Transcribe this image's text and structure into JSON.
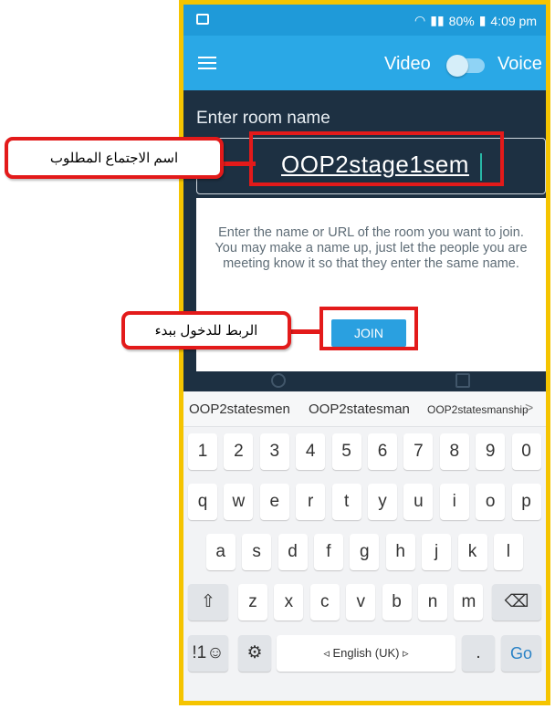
{
  "status_bar": {
    "time": "4:09 pm",
    "battery": "80%"
  },
  "app_bar": {
    "video_label": "Video",
    "voice_label": "Voice"
  },
  "room": {
    "label": "Enter room name",
    "input_value": "OOP2stage1sem",
    "description": "Enter the name or URL of the room you want to join. You may make a name up, just let the people you are meeting know it so that they enter the same name.",
    "join_label": "JOIN"
  },
  "keyboard": {
    "suggestions": [
      "OOP2statesmen",
      "OOP2statesman",
      "OOP2statesmanship"
    ],
    "more": ">",
    "row_numbers": [
      "1",
      "2",
      "3",
      "4",
      "5",
      "6",
      "7",
      "8",
      "9",
      "0"
    ],
    "row1": [
      "q",
      "w",
      "e",
      "r",
      "t",
      "y",
      "u",
      "i",
      "o",
      "p"
    ],
    "row2": [
      "a",
      "s",
      "d",
      "f",
      "g",
      "h",
      "j",
      "k",
      "l"
    ],
    "row3": [
      "z",
      "x",
      "c",
      "v",
      "b",
      "n",
      "m"
    ],
    "shift": "⇧",
    "backspace": "⌫",
    "symbols": "!1☺",
    "settings": "⚙",
    "space": "◃ English (UK) ▹",
    "period": ".",
    "go": "Go"
  },
  "annotations": {
    "room_name_note": "اسم الاجتماع المطلوب",
    "join_note": "الربط للدخول ببدء"
  },
  "colors": {
    "annotation_red": "#e31a1a",
    "frame_yellow": "#f5c400",
    "app_blue": "#2aa8e6"
  }
}
